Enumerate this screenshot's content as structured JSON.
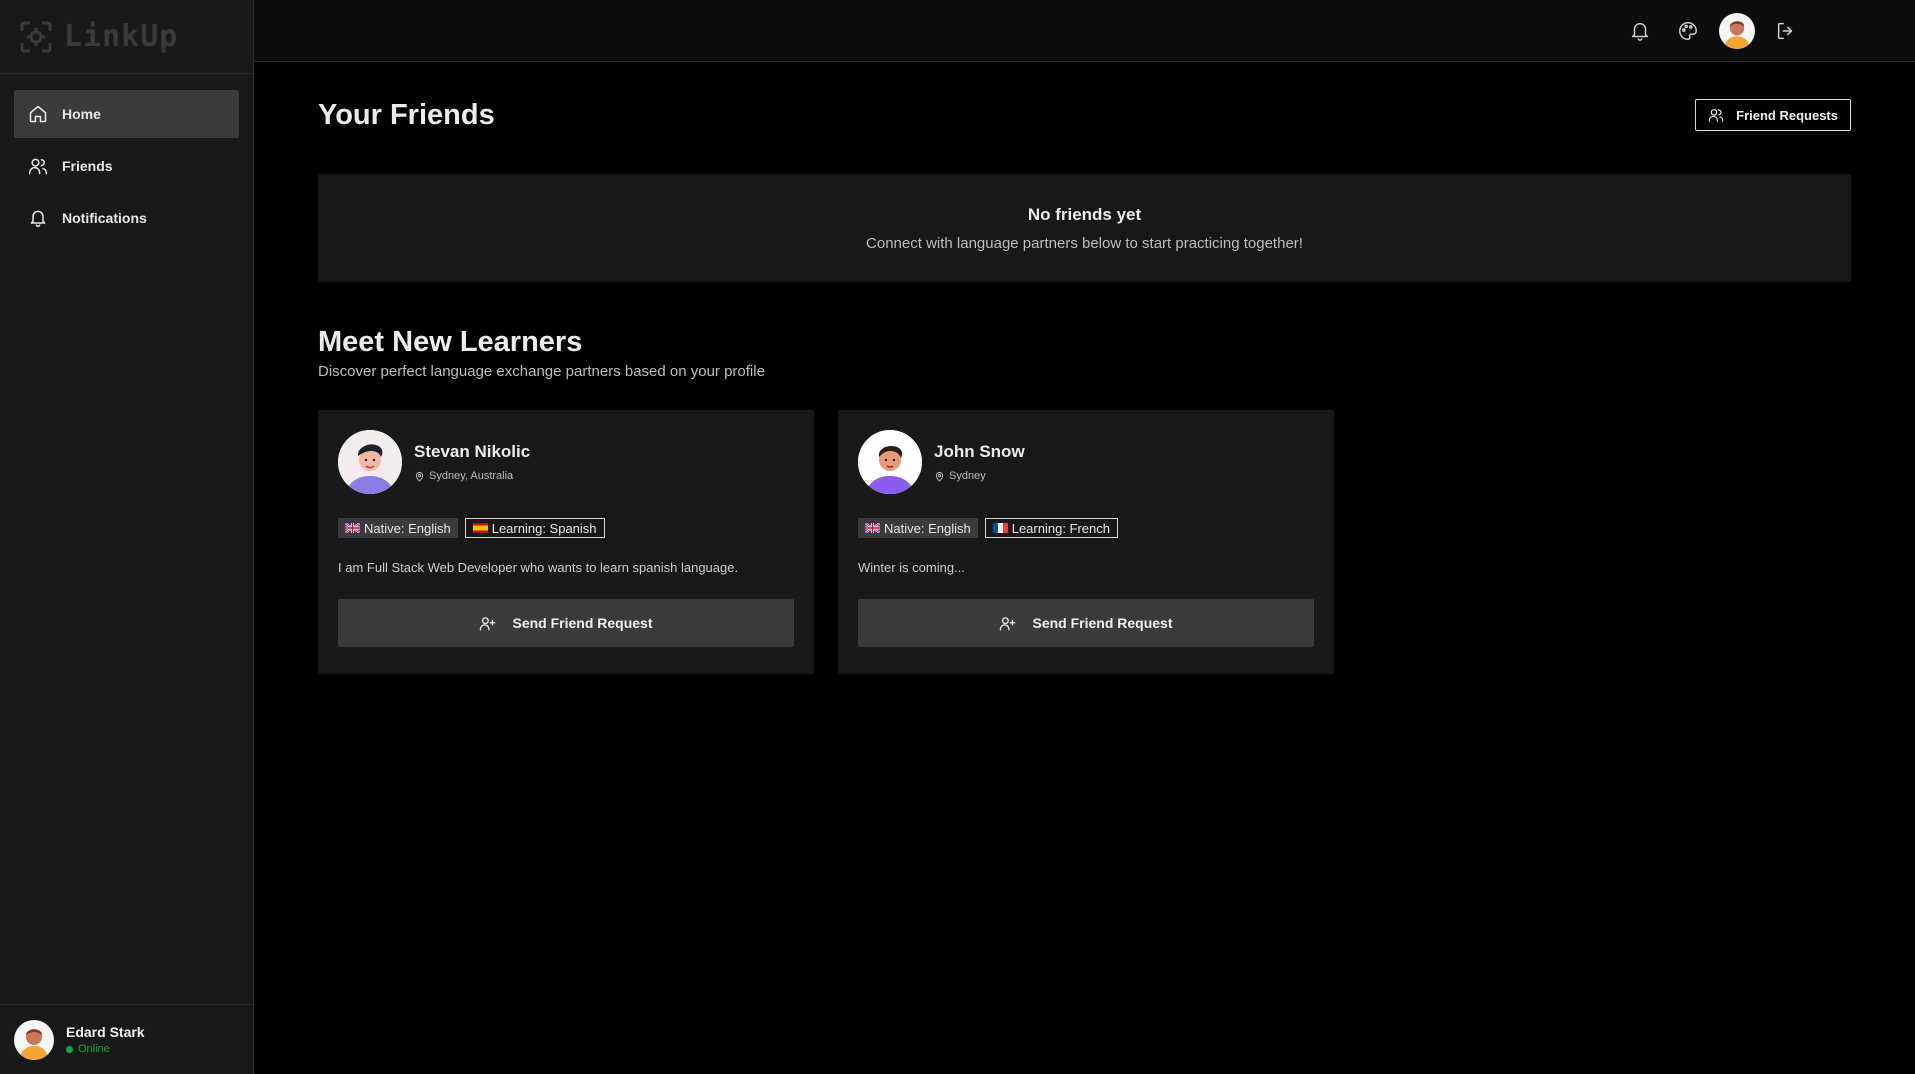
{
  "app": {
    "name": "LinkUp"
  },
  "sidebar": {
    "items": [
      {
        "label": "Home",
        "icon": "home-icon",
        "active": true
      },
      {
        "label": "Friends",
        "icon": "users-icon",
        "active": false
      },
      {
        "label": "Notifications",
        "icon": "bell-icon",
        "active": false
      }
    ],
    "user": {
      "name": "Edard Stark",
      "status": "Online"
    }
  },
  "topbar": {
    "icons": [
      "bell-icon",
      "palette-icon",
      "avatar",
      "logout-icon"
    ]
  },
  "friends_section": {
    "title": "Your Friends",
    "requests_button": "Friend Requests",
    "empty_title": "No friends yet",
    "empty_subtitle": "Connect with language partners below to start practicing together!"
  },
  "learners_section": {
    "title": "Meet New Learners",
    "subtitle": "Discover perfect language exchange partners based on your profile",
    "cards": [
      {
        "name": "Stevan Nikolic",
        "location": "Sydney, Australia",
        "native": "Native: English",
        "learning": "Learning: Spanish",
        "bio": "I am Full Stack Web Developer who wants to learn spanish language.",
        "button": "Send Friend Request"
      },
      {
        "name": "John Snow",
        "location": "Sydney",
        "native": "Native: English",
        "learning": "Learning: French",
        "bio": "Winter is coming...",
        "button": "Send Friend Request"
      }
    ]
  },
  "colors": {
    "background": "#000000",
    "sidebar": "#191919",
    "card": "#191919",
    "active": "#3b3b3b",
    "online": "#1aa34a"
  }
}
